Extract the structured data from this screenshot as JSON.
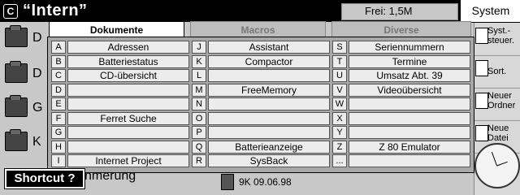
{
  "titlebar": {
    "logo": "C",
    "title": "“Intern”",
    "free": "Frei: 1,5M"
  },
  "system_tab": "System",
  "background": {
    "letters": [
      "D",
      "D",
      "G",
      "K"
    ],
    "partial_text": "nmerung",
    "file_info": "9K 09.06.98"
  },
  "sidebar": [
    {
      "label": "Syst.-steuer."
    },
    {
      "label": "Sort."
    },
    {
      "label": "Neuer Ordner"
    },
    {
      "label": "Neue Datei"
    }
  ],
  "shortcut_label": "Shortcut ?",
  "dialog": {
    "tabs": [
      {
        "label": "Dokumente"
      },
      {
        "label": "Macros"
      },
      {
        "label": "Diverse"
      }
    ],
    "columns": [
      {
        "rows": [
          {
            "key": "A",
            "value": "Adressen"
          },
          {
            "key": "B",
            "value": "Batteriestatus"
          },
          {
            "key": "C",
            "value": "CD-übersicht"
          },
          {
            "key": "D",
            "value": ""
          },
          {
            "key": "E",
            "value": ""
          },
          {
            "key": "F",
            "value": "Ferret Suche"
          },
          {
            "key": "G",
            "value": ""
          },
          {
            "key": "H",
            "value": ""
          },
          {
            "key": "I",
            "value": "Internet Project"
          }
        ]
      },
      {
        "rows": [
          {
            "key": "J",
            "value": "Assistant"
          },
          {
            "key": "K",
            "value": "Compactor"
          },
          {
            "key": "L",
            "value": ""
          },
          {
            "key": "M",
            "value": "FreeMemory"
          },
          {
            "key": "N",
            "value": ""
          },
          {
            "key": "O",
            "value": ""
          },
          {
            "key": "P",
            "value": ""
          },
          {
            "key": "Q",
            "value": "Batterieanzeige"
          },
          {
            "key": "R",
            "value": "SysBack"
          }
        ]
      },
      {
        "rows": [
          {
            "key": "S",
            "value": "Seriennummern"
          },
          {
            "key": "T",
            "value": "Termine"
          },
          {
            "key": "U",
            "value": "Umsatz Abt. 39"
          },
          {
            "key": "V",
            "value": "Videoübersicht"
          },
          {
            "key": "W",
            "value": ""
          },
          {
            "key": "X",
            "value": ""
          },
          {
            "key": "Y",
            "value": ""
          },
          {
            "key": "Z",
            "value": "Z 80 Emulator"
          },
          {
            "key": "...",
            "value": ""
          }
        ]
      }
    ]
  }
}
